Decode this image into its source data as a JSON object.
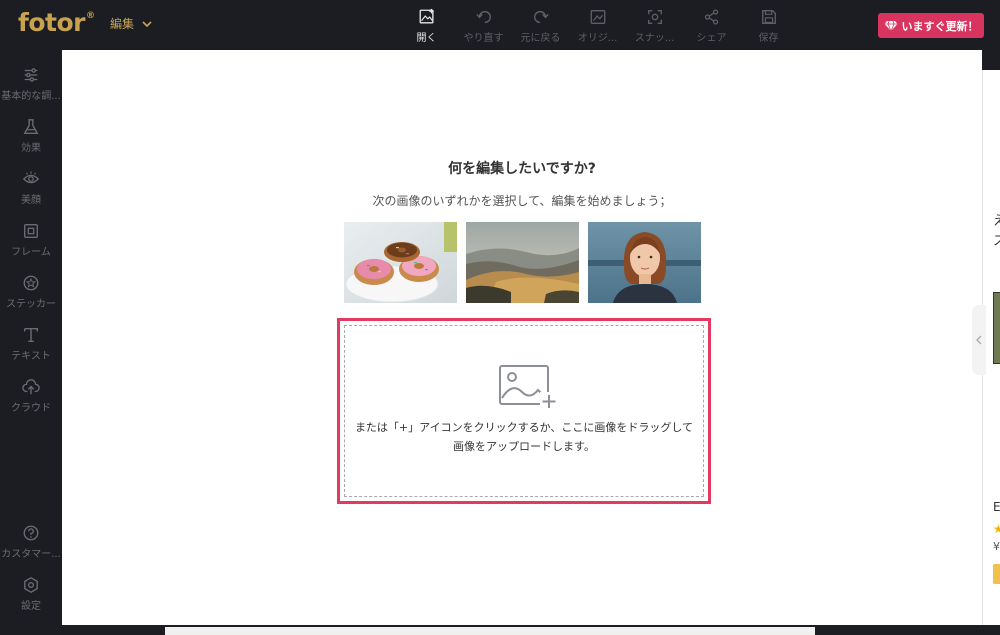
{
  "app": {
    "logo_text": "fotor",
    "logo_mark": "®",
    "edit_menu_label": "編集",
    "update_button_label": "いますぐ更新！"
  },
  "toolbar": {
    "items": [
      {
        "label": "開く",
        "icon": "open-image-icon",
        "active": true
      },
      {
        "label": "やり直す",
        "icon": "undo-icon",
        "active": false
      },
      {
        "label": "元に戻る",
        "icon": "redo-icon",
        "active": false
      },
      {
        "label": "オリジ...",
        "icon": "original-icon",
        "active": false
      },
      {
        "label": "スナッ...",
        "icon": "snapshot-icon",
        "active": false
      },
      {
        "label": "シェア",
        "icon": "share-icon",
        "active": false
      },
      {
        "label": "保存",
        "icon": "save-icon",
        "active": false
      }
    ]
  },
  "sidebar": {
    "items": [
      {
        "label": "基本的な調...",
        "icon": "sliders-icon"
      },
      {
        "label": "効果",
        "icon": "flask-icon"
      },
      {
        "label": "美顔",
        "icon": "eye-icon"
      },
      {
        "label": "フレーム",
        "icon": "frame-icon"
      },
      {
        "label": "ステッカー",
        "icon": "sticker-icon"
      },
      {
        "label": "テキスト",
        "icon": "text-icon"
      },
      {
        "label": "クラウド",
        "icon": "cloud-upload-icon"
      }
    ],
    "bottom_items": [
      {
        "label": "カスタマー...",
        "icon": "help-icon"
      },
      {
        "label": "設定",
        "icon": "settings-icon"
      }
    ]
  },
  "main": {
    "title": "何を編集したいですか?",
    "subtitle": "次の画像のいずれかを選択して、編集を始めましょう；",
    "sample_images": [
      "donuts-sample",
      "landscape-sample",
      "portrait-sample"
    ],
    "dropzone_line1": "または「+」アイコンをクリックするか、ここに画像をドラッグして",
    "dropzone_line2": "画像をアップロードします。"
  },
  "right_panel": {
    "char1": "え",
    "char2": "ス",
    "label_e": "E",
    "price_prefix": "¥"
  },
  "colors": {
    "background": "#1c1d22",
    "accent_gold": "#c8a24c",
    "update_button": "#d8345f",
    "dropzone_border": "#e23a60"
  }
}
